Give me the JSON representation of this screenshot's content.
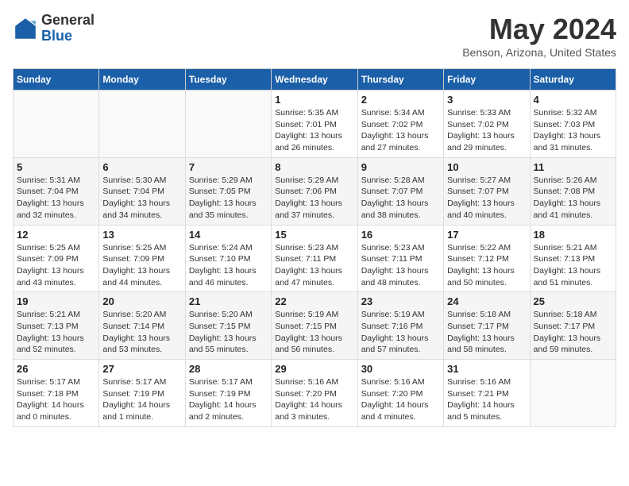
{
  "logo": {
    "general": "General",
    "blue": "Blue"
  },
  "title": "May 2024",
  "subtitle": "Benson, Arizona, United States",
  "days_of_week": [
    "Sunday",
    "Monday",
    "Tuesday",
    "Wednesday",
    "Thursday",
    "Friday",
    "Saturday"
  ],
  "weeks": [
    [
      {
        "date": "",
        "info": ""
      },
      {
        "date": "",
        "info": ""
      },
      {
        "date": "",
        "info": ""
      },
      {
        "date": "1",
        "info": "Sunrise: 5:35 AM\nSunset: 7:01 PM\nDaylight: 13 hours\nand 26 minutes."
      },
      {
        "date": "2",
        "info": "Sunrise: 5:34 AM\nSunset: 7:02 PM\nDaylight: 13 hours\nand 27 minutes."
      },
      {
        "date": "3",
        "info": "Sunrise: 5:33 AM\nSunset: 7:02 PM\nDaylight: 13 hours\nand 29 minutes."
      },
      {
        "date": "4",
        "info": "Sunrise: 5:32 AM\nSunset: 7:03 PM\nDaylight: 13 hours\nand 31 minutes."
      }
    ],
    [
      {
        "date": "5",
        "info": "Sunrise: 5:31 AM\nSunset: 7:04 PM\nDaylight: 13 hours\nand 32 minutes."
      },
      {
        "date": "6",
        "info": "Sunrise: 5:30 AM\nSunset: 7:04 PM\nDaylight: 13 hours\nand 34 minutes."
      },
      {
        "date": "7",
        "info": "Sunrise: 5:29 AM\nSunset: 7:05 PM\nDaylight: 13 hours\nand 35 minutes."
      },
      {
        "date": "8",
        "info": "Sunrise: 5:29 AM\nSunset: 7:06 PM\nDaylight: 13 hours\nand 37 minutes."
      },
      {
        "date": "9",
        "info": "Sunrise: 5:28 AM\nSunset: 7:07 PM\nDaylight: 13 hours\nand 38 minutes."
      },
      {
        "date": "10",
        "info": "Sunrise: 5:27 AM\nSunset: 7:07 PM\nDaylight: 13 hours\nand 40 minutes."
      },
      {
        "date": "11",
        "info": "Sunrise: 5:26 AM\nSunset: 7:08 PM\nDaylight: 13 hours\nand 41 minutes."
      }
    ],
    [
      {
        "date": "12",
        "info": "Sunrise: 5:25 AM\nSunset: 7:09 PM\nDaylight: 13 hours\nand 43 minutes."
      },
      {
        "date": "13",
        "info": "Sunrise: 5:25 AM\nSunset: 7:09 PM\nDaylight: 13 hours\nand 44 minutes."
      },
      {
        "date": "14",
        "info": "Sunrise: 5:24 AM\nSunset: 7:10 PM\nDaylight: 13 hours\nand 46 minutes."
      },
      {
        "date": "15",
        "info": "Sunrise: 5:23 AM\nSunset: 7:11 PM\nDaylight: 13 hours\nand 47 minutes."
      },
      {
        "date": "16",
        "info": "Sunrise: 5:23 AM\nSunset: 7:11 PM\nDaylight: 13 hours\nand 48 minutes."
      },
      {
        "date": "17",
        "info": "Sunrise: 5:22 AM\nSunset: 7:12 PM\nDaylight: 13 hours\nand 50 minutes."
      },
      {
        "date": "18",
        "info": "Sunrise: 5:21 AM\nSunset: 7:13 PM\nDaylight: 13 hours\nand 51 minutes."
      }
    ],
    [
      {
        "date": "19",
        "info": "Sunrise: 5:21 AM\nSunset: 7:13 PM\nDaylight: 13 hours\nand 52 minutes."
      },
      {
        "date": "20",
        "info": "Sunrise: 5:20 AM\nSunset: 7:14 PM\nDaylight: 13 hours\nand 53 minutes."
      },
      {
        "date": "21",
        "info": "Sunrise: 5:20 AM\nSunset: 7:15 PM\nDaylight: 13 hours\nand 55 minutes."
      },
      {
        "date": "22",
        "info": "Sunrise: 5:19 AM\nSunset: 7:15 PM\nDaylight: 13 hours\nand 56 minutes."
      },
      {
        "date": "23",
        "info": "Sunrise: 5:19 AM\nSunset: 7:16 PM\nDaylight: 13 hours\nand 57 minutes."
      },
      {
        "date": "24",
        "info": "Sunrise: 5:18 AM\nSunset: 7:17 PM\nDaylight: 13 hours\nand 58 minutes."
      },
      {
        "date": "25",
        "info": "Sunrise: 5:18 AM\nSunset: 7:17 PM\nDaylight: 13 hours\nand 59 minutes."
      }
    ],
    [
      {
        "date": "26",
        "info": "Sunrise: 5:17 AM\nSunset: 7:18 PM\nDaylight: 14 hours\nand 0 minutes."
      },
      {
        "date": "27",
        "info": "Sunrise: 5:17 AM\nSunset: 7:19 PM\nDaylight: 14 hours\nand 1 minute."
      },
      {
        "date": "28",
        "info": "Sunrise: 5:17 AM\nSunset: 7:19 PM\nDaylight: 14 hours\nand 2 minutes."
      },
      {
        "date": "29",
        "info": "Sunrise: 5:16 AM\nSunset: 7:20 PM\nDaylight: 14 hours\nand 3 minutes."
      },
      {
        "date": "30",
        "info": "Sunrise: 5:16 AM\nSunset: 7:20 PM\nDaylight: 14 hours\nand 4 minutes."
      },
      {
        "date": "31",
        "info": "Sunrise: 5:16 AM\nSunset: 7:21 PM\nDaylight: 14 hours\nand 5 minutes."
      },
      {
        "date": "",
        "info": ""
      }
    ]
  ]
}
